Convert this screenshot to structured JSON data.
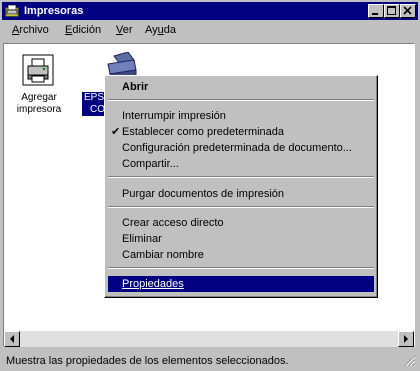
{
  "window": {
    "title": "Impresoras"
  },
  "menubar": [
    {
      "label": "Archivo",
      "mnemonic": "A"
    },
    {
      "label": "Edición",
      "mnemonic": "E"
    },
    {
      "label": "Ver",
      "mnemonic": "V"
    },
    {
      "label": "Ayuda",
      "mnemonic": "u"
    }
  ],
  "icons": [
    {
      "name": "add-printer",
      "label_line1": "Agregar",
      "label_line2": "impresora",
      "icon": "add-printer-icon"
    },
    {
      "name": "epson-printer",
      "label_line1": "EPS",
      "label_line2": "CO",
      "icon": "printer-icon",
      "selected": true
    }
  ],
  "context_menu": {
    "items": [
      {
        "label": "Abrir",
        "bold": true
      },
      {
        "separator": true
      },
      {
        "label": "Interrumpir impresión"
      },
      {
        "label": "Establecer como predeterminada",
        "checked": true
      },
      {
        "label": "Configuración predeterminada de documento..."
      },
      {
        "label": "Compartir..."
      },
      {
        "separator": true
      },
      {
        "label": "Purgar documentos de impresión"
      },
      {
        "separator": true
      },
      {
        "label": "Crear acceso directo"
      },
      {
        "label": "Eliminar"
      },
      {
        "label": "Cambiar nombre"
      },
      {
        "separator": true
      },
      {
        "label": "Propiedades",
        "highlighted": true
      }
    ]
  },
  "statusbar": {
    "text": "Muestra las propiedades de los elementos seleccionados."
  },
  "colors": {
    "titlebar": "#000080",
    "face": "#c0c0c0",
    "highlight": "#000080"
  }
}
